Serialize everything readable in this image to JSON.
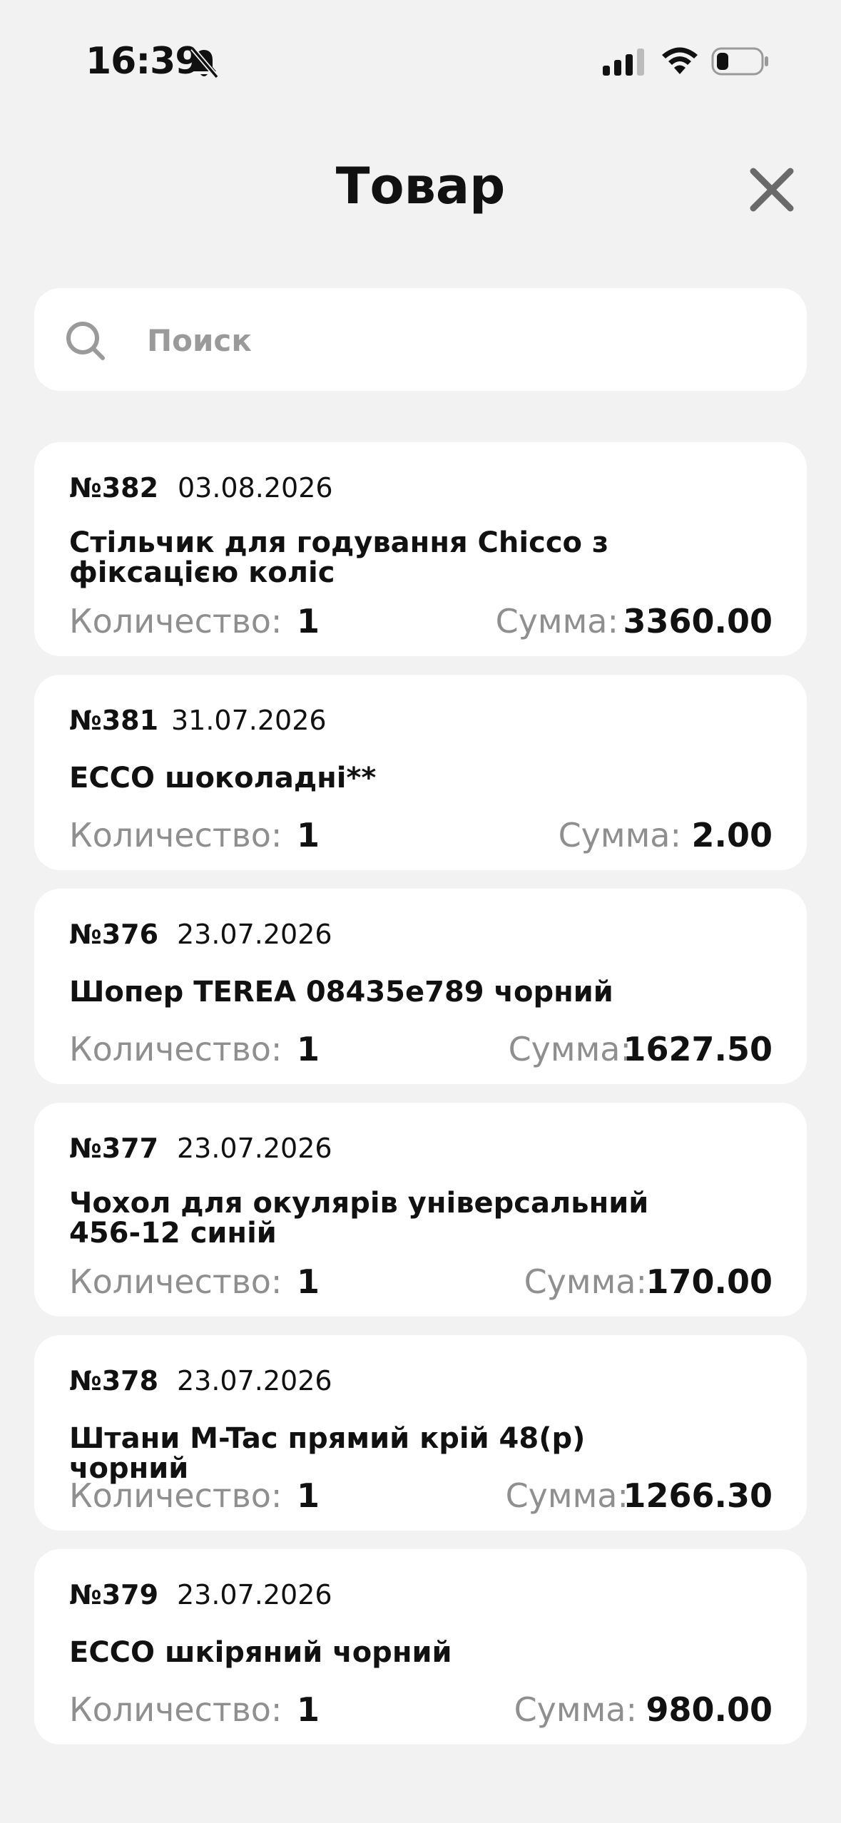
{
  "status_bar": {
    "time": "16:39",
    "icons": [
      "bell-slash-icon",
      "cellular-signal-icon",
      "wifi-icon",
      "battery-icon"
    ]
  },
  "header": {
    "title": "Товар",
    "close_icon": "close-icon"
  },
  "search": {
    "placeholder": "Поиск",
    "value": "",
    "icon": "search-icon"
  },
  "labels": {
    "quantity": "Количество:",
    "sum": "Сумма:"
  },
  "items": [
    {
      "number": "№382",
      "date": "03.08.2026",
      "name": "Стільчик для годування Chicco з фіксацією коліс",
      "quantity": "1",
      "sum": "3360.00"
    },
    {
      "number": "№381",
      "date": "31.07.2026",
      "name": "ECCO шоколадні**",
      "quantity": "1",
      "sum": "2.00"
    },
    {
      "number": "№376",
      "date": "23.07.2026",
      "name": "Шопер TEREA 08435e789 чорний",
      "quantity": "1",
      "sum": "1627.50"
    },
    {
      "number": "№377",
      "date": "23.07.2026",
      "name": "Чохол для окулярів універсальний 456-12 синій",
      "quantity": "1",
      "sum": "170.00"
    },
    {
      "number": "№378",
      "date": "23.07.2026",
      "name": "Штани M-Tac прямий крій 48(р) чорний",
      "quantity": "1",
      "sum": "1266.30"
    },
    {
      "number": "№379",
      "date": "23.07.2026",
      "name": "ECCO шкіряний чорний",
      "quantity": "1",
      "sum": "980.00"
    }
  ]
}
